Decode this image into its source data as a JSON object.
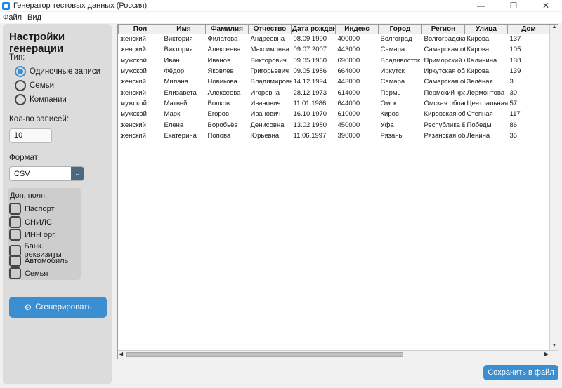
{
  "window": {
    "title": "Генератор тестовых данных (Россия)",
    "minimize": "—",
    "maximize": "☐",
    "close": "✕"
  },
  "menu": [
    "Файл",
    "Вид"
  ],
  "sidebar": {
    "title": "Настройки генерации",
    "type_label": "Тип:",
    "types": [
      {
        "label": "Одиночные записи",
        "selected": true
      },
      {
        "label": "Семьи",
        "selected": false
      },
      {
        "label": "Компании",
        "selected": false
      }
    ],
    "count_label": "Кол-во записей:",
    "count_value": "10",
    "format_label": "Формат:",
    "format_value": "CSV",
    "extra_label": "Доп. поля:",
    "extras": [
      {
        "label": "Паспорт",
        "checked": false
      },
      {
        "label": "СНИЛС",
        "checked": false
      },
      {
        "label": "ИНН орг.",
        "checked": false
      },
      {
        "label": "Банк. реквизиты",
        "checked": false
      },
      {
        "label": "Автомобиль",
        "checked": false
      },
      {
        "label": "Семья",
        "checked": false
      }
    ],
    "generate_label": "Сгенерировать"
  },
  "table": {
    "columns": [
      "Пол",
      "Имя",
      "Фамилия",
      "Отчество",
      "Дата рождения",
      "Индекс",
      "Город",
      "Регион",
      "Улица",
      "Дом"
    ],
    "rows": [
      [
        "женский",
        "Виктория",
        "Филатова",
        "Андреевна",
        "08.09.1990",
        "400000",
        "Волгоград",
        "Волгоградская обл",
        "Кирова",
        "137"
      ],
      [
        "женский",
        "Виктория",
        "Алексеева",
        "Максимовна",
        "09.07.2007",
        "443000",
        "Самара",
        "Самарская обл",
        "Кирова",
        "105"
      ],
      [
        "мужской",
        "Иван",
        "Иванов",
        "Викторович",
        "09.05.1960",
        "690000",
        "Владивосток",
        "Приморский край",
        "Калинина",
        "138"
      ],
      [
        "мужской",
        "Фёдор",
        "Яковлев",
        "Григорьевич",
        "09.05.1986",
        "664000",
        "Иркутск",
        "Иркутская обл",
        "Кирова",
        "139"
      ],
      [
        "женский",
        "Милана",
        "Новикова",
        "Владимировна",
        "14.12.1994",
        "443000",
        "Самара",
        "Самарская обл",
        "Зелёная",
        "3"
      ],
      [
        "женский",
        "Елизавета",
        "Алексеева",
        "Игоревна",
        "28.12.1973",
        "614000",
        "Пермь",
        "Пермский край",
        "Лермонтова",
        "30"
      ],
      [
        "мужской",
        "Матвей",
        "Волков",
        "Иванович",
        "11.01.1986",
        "644000",
        "Омск",
        "Омская область",
        "Центральная",
        "57"
      ],
      [
        "мужской",
        "Марк",
        "Егоров",
        "Иванович",
        "16.10.1970",
        "610000",
        "Киров",
        "Кировская обл",
        "Степная",
        "117"
      ],
      [
        "женский",
        "Елена",
        "Воробьёв",
        "Денисовна",
        "13.02.1980",
        "450000",
        "Уфа",
        "Республика Башкортостан",
        "Победы",
        "86"
      ],
      [
        "женский",
        "Екатерина",
        "Попова",
        "Юрьевна",
        "11.06.1997",
        "390000",
        "Рязань",
        "Рязанская обл",
        "Ленина",
        "35"
      ]
    ]
  },
  "save_label": "Сохранить в файл"
}
